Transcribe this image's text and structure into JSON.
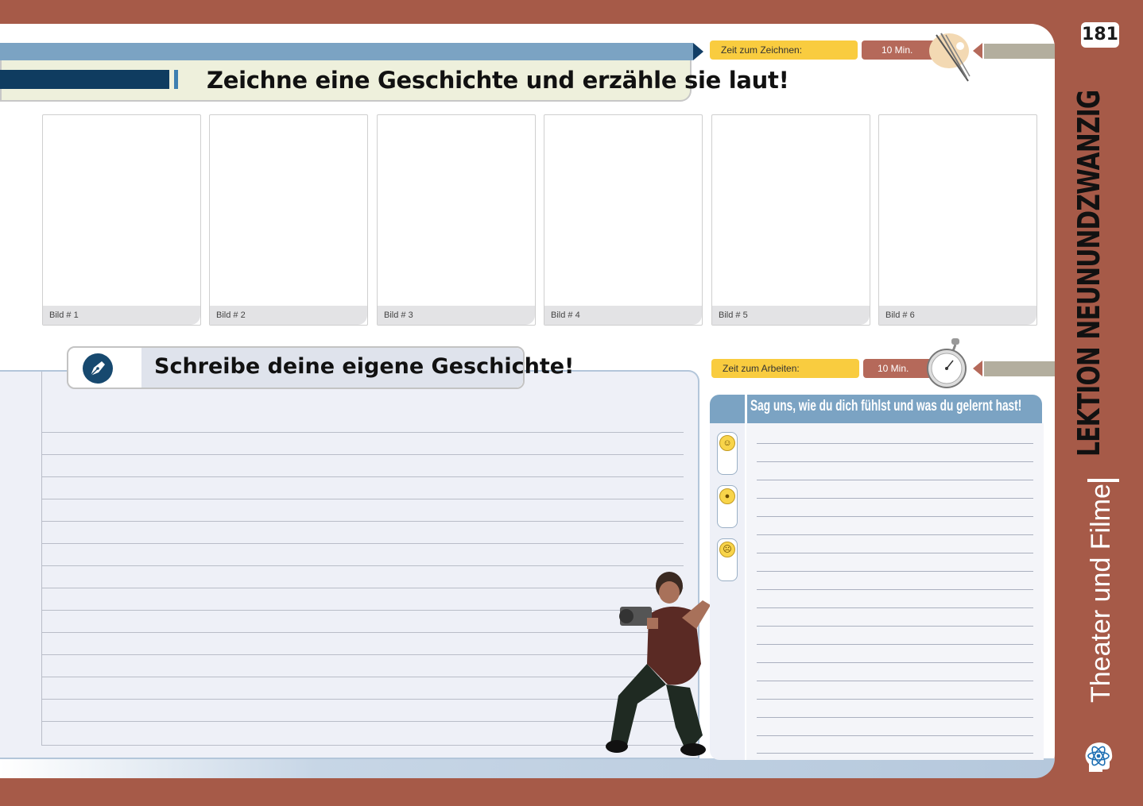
{
  "page_number": "181",
  "lesson_title": "LEKTION NEUNUNDZWANZIG",
  "topic_title": "Theater und Filme",
  "separator": "|",
  "draw_section": {
    "title": "Zeichne eine Geschichte und erzähle sie laut!",
    "time_label": "Zeit zum Zeichnen:",
    "time_value": "10 Min.",
    "icon": "brush-palette-icon",
    "panels": [
      "Bild # 1",
      "Bild # 2",
      "Bild # 3",
      "Bild # 4",
      "Bild # 5",
      "Bild # 6"
    ]
  },
  "write_section": {
    "title": "Schreibe deine eigene Geschichte!",
    "icon": "pen-nib-icon",
    "line_count": 14
  },
  "reflect_section": {
    "time_label": "Zeit zum Arbeiten:",
    "time_value": "10 Min.",
    "icon": "stopwatch-icon",
    "title": "Sag uns, wie du dich fühlst und was du gelernt hast!",
    "faces": [
      "happy-face-icon",
      "neutral-face-icon",
      "sad-face-icon"
    ]
  },
  "colors": {
    "frame": "#a65a48",
    "accent_blue": "#7ba3c3",
    "dark_blue": "#0f3c60",
    "time_yellow": "#f9cc3f",
    "time_red": "#b5695a"
  }
}
